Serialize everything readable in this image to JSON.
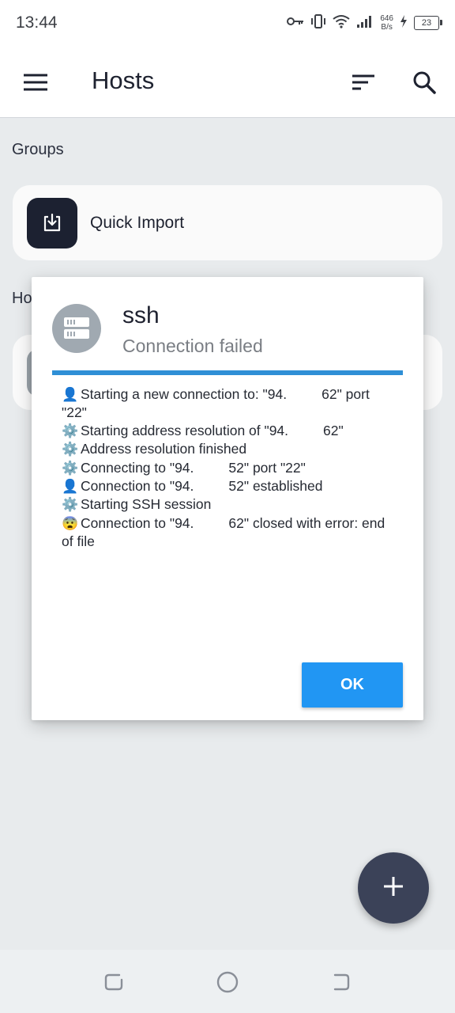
{
  "status_bar": {
    "time": "13:44",
    "net_speed_value": "646",
    "net_speed_unit": "B/s",
    "battery": "23",
    "icons": [
      "vpn-key-icon",
      "vibrate-icon",
      "wifi-icon",
      "signal-icon",
      "charging-icon",
      "battery-icon"
    ]
  },
  "app_bar": {
    "title": "Hosts",
    "icons": [
      "menu-icon",
      "sort-icon",
      "search-icon"
    ]
  },
  "groups": {
    "label": "Groups",
    "items": [
      {
        "label": "Quick Import",
        "icon": "import-icon"
      }
    ]
  },
  "hosts": {
    "label_visible": "Ho"
  },
  "dialog": {
    "title": "ssh",
    "subtitle": "Connection failed",
    "icon": "server-icon",
    "progress": 1.0,
    "log": [
      {
        "emoji": "👤",
        "text_a": "Starting a new connection to: \"94.",
        "text_b": "62\" port \"22\""
      },
      {
        "emoji": "⚙️",
        "text_a": "Starting address resolution of \"94.",
        "text_b": "62\""
      },
      {
        "emoji": "⚙️",
        "text_a": "Address resolution finished",
        "text_b": ""
      },
      {
        "emoji": "⚙️",
        "text_a": "Connecting to \"94.",
        "text_b": "52\" port \"22\""
      },
      {
        "emoji": "👤",
        "text_a": "Connection to \"94.",
        "text_b": "52\" established"
      },
      {
        "emoji": "⚙️",
        "text_a": "Starting SSH session",
        "text_b": ""
      },
      {
        "emoji": "😨",
        "text_a": "Connection to \"94.",
        "text_b": "62\" closed with error: end of file"
      }
    ],
    "ok_label": "OK"
  },
  "fab": {
    "icon": "plus-icon"
  },
  "nav_bar": {
    "icons": [
      "recents-icon",
      "home-icon",
      "back-icon"
    ]
  },
  "colors": {
    "accent": "#2196f3",
    "progress": "#2f8fd6",
    "fab": "#3b4258",
    "import_tile": "#1d2232",
    "background": "#edf0f2"
  }
}
